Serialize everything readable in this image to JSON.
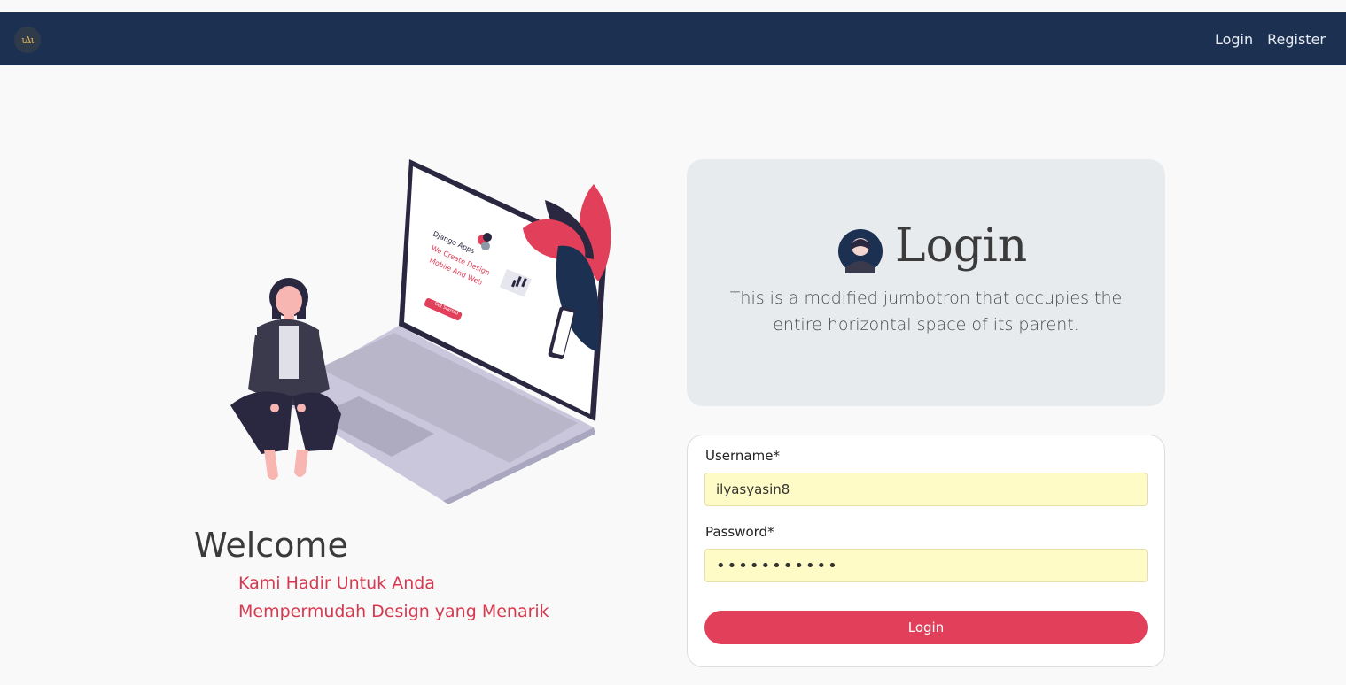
{
  "navbar": {
    "brand_text": "ιΔι",
    "links": [
      "Login",
      "Register"
    ]
  },
  "illustration": {
    "screen_title": "Django Apps",
    "screen_heading_1": "We Create Design",
    "screen_heading_2": "Mobile And Web",
    "screen_button": "Get Started"
  },
  "welcome": {
    "title": "Welcome",
    "line1": "Kami Hadir Untuk Anda",
    "line2": "Mempermudah Design yang Menarik"
  },
  "jumbotron": {
    "title": "Login",
    "lead": "This is a modified jumbotron that occupies the entire horizontal space of its parent."
  },
  "form": {
    "username_label": "Username*",
    "username_value": "ilyasyasin8",
    "password_label": "Password*",
    "password_value": "•••••••••••",
    "submit_label": "Login"
  },
  "colors": {
    "navbar": "#1c3152",
    "accent": "#e2405a",
    "autofill": "#fffbc7"
  }
}
